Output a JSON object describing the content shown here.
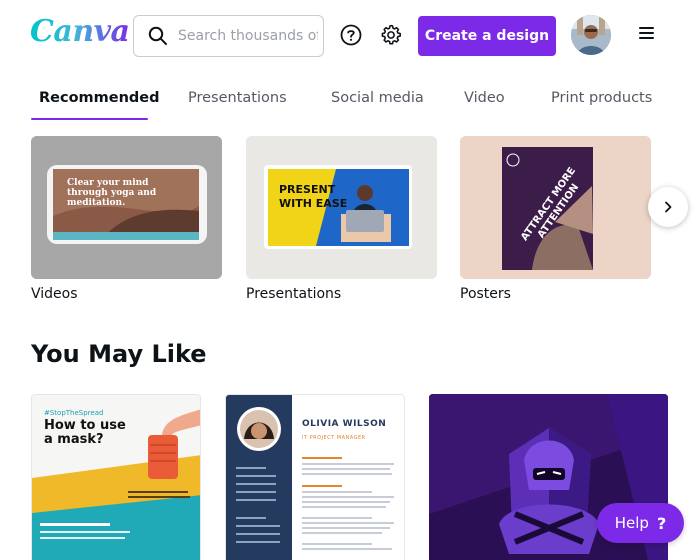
{
  "header": {
    "logo": "Canva",
    "search_placeholder": "Search thousands of templates",
    "create_label": "Create a design"
  },
  "tabs": [
    {
      "label": "Recommended",
      "active": true
    },
    {
      "label": "Presentations",
      "active": false
    },
    {
      "label": "Social media",
      "active": false
    },
    {
      "label": "Video",
      "active": false
    },
    {
      "label": "Print products",
      "active": false
    }
  ],
  "categories": [
    {
      "label": "Videos",
      "thumb_text": "Clear your mind through yoga and meditation."
    },
    {
      "label": "Presentations",
      "thumb_text": "PRESENT WITH EASE"
    },
    {
      "label": "Posters",
      "thumb_text": "ATTRACT MORE ATTENTION"
    }
  ],
  "you_may_like": {
    "title": "You May Like",
    "cards": [
      {
        "tag": "#StopTheSpread",
        "heading": "How to use a mask?"
      },
      {
        "name": "OLIVIA WILSON",
        "role": "IT PROJECT MANAGER"
      },
      {
        "kind": "mascot-logo"
      }
    ]
  },
  "help_label": "Help",
  "colors": {
    "accent": "#7d2ae8",
    "teal": "#00c4cc"
  }
}
